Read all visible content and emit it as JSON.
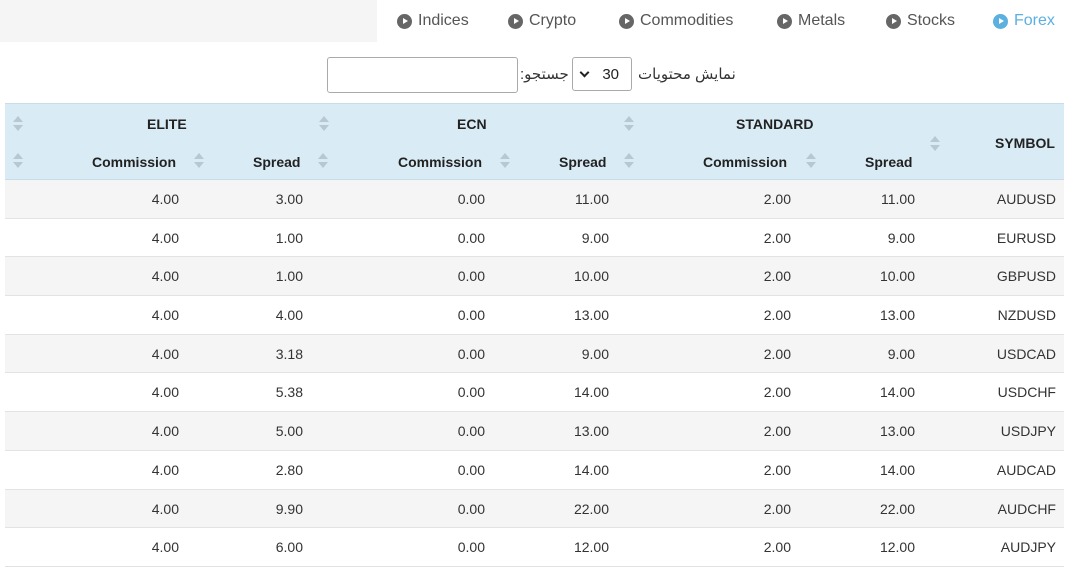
{
  "tabs": [
    {
      "label": "Indices",
      "active": false,
      "icon": "circle-arrow-right-icon"
    },
    {
      "label": "Crypto",
      "active": false,
      "icon": "circle-arrow-right-icon"
    },
    {
      "label": "Commodities",
      "active": false,
      "icon": "circle-arrow-right-icon"
    },
    {
      "label": "Metals",
      "active": false,
      "icon": "circle-arrow-right-icon"
    },
    {
      "label": "Stocks",
      "active": false,
      "icon": "circle-arrow-right-icon"
    },
    {
      "label": "Forex",
      "active": true,
      "icon": "circle-arrow-right-icon"
    }
  ],
  "controls": {
    "length_label": "نمایش محتویات",
    "length_value": "30",
    "search_label": "جستجو:",
    "search_value": ""
  },
  "table": {
    "groups": {
      "standard": "STANDARD",
      "ecn": "ECN",
      "elite": "ELITE"
    },
    "symbol_header": "SYMBOL",
    "spread_header": "Spread",
    "commission_header": "Commission",
    "rows": [
      {
        "symbol": "AUDUSD",
        "std_spread": "11.00",
        "std_comm": "2.00",
        "ecn_spread": "11.00",
        "ecn_comm": "0.00",
        "elite_spread": "3.00",
        "elite_comm": "4.00"
      },
      {
        "symbol": "EURUSD",
        "std_spread": "9.00",
        "std_comm": "2.00",
        "ecn_spread": "9.00",
        "ecn_comm": "0.00",
        "elite_spread": "1.00",
        "elite_comm": "4.00"
      },
      {
        "symbol": "GBPUSD",
        "std_spread": "10.00",
        "std_comm": "2.00",
        "ecn_spread": "10.00",
        "ecn_comm": "0.00",
        "elite_spread": "1.00",
        "elite_comm": "4.00"
      },
      {
        "symbol": "NZDUSD",
        "std_spread": "13.00",
        "std_comm": "2.00",
        "ecn_spread": "13.00",
        "ecn_comm": "0.00",
        "elite_spread": "4.00",
        "elite_comm": "4.00"
      },
      {
        "symbol": "USDCAD",
        "std_spread": "9.00",
        "std_comm": "2.00",
        "ecn_spread": "9.00",
        "ecn_comm": "0.00",
        "elite_spread": "3.18",
        "elite_comm": "4.00"
      },
      {
        "symbol": "USDCHF",
        "std_spread": "14.00",
        "std_comm": "2.00",
        "ecn_spread": "14.00",
        "ecn_comm": "0.00",
        "elite_spread": "5.38",
        "elite_comm": "4.00"
      },
      {
        "symbol": "USDJPY",
        "std_spread": "13.00",
        "std_comm": "2.00",
        "ecn_spread": "13.00",
        "ecn_comm": "0.00",
        "elite_spread": "5.00",
        "elite_comm": "4.00"
      },
      {
        "symbol": "AUDCAD",
        "std_spread": "14.00",
        "std_comm": "2.00",
        "ecn_spread": "14.00",
        "ecn_comm": "0.00",
        "elite_spread": "2.80",
        "elite_comm": "4.00"
      },
      {
        "symbol": "AUDCHF",
        "std_spread": "22.00",
        "std_comm": "2.00",
        "ecn_spread": "22.00",
        "ecn_comm": "0.00",
        "elite_spread": "9.90",
        "elite_comm": "4.00"
      },
      {
        "symbol": "AUDJPY",
        "std_spread": "12.00",
        "std_comm": "2.00",
        "ecn_spread": "12.00",
        "ecn_comm": "0.00",
        "elite_spread": "6.00",
        "elite_comm": "4.00"
      }
    ]
  },
  "colors": {
    "header_bg": "#d9ebf5",
    "active_tab": "#5bb0e0",
    "row_odd": "#f5f5f5"
  }
}
